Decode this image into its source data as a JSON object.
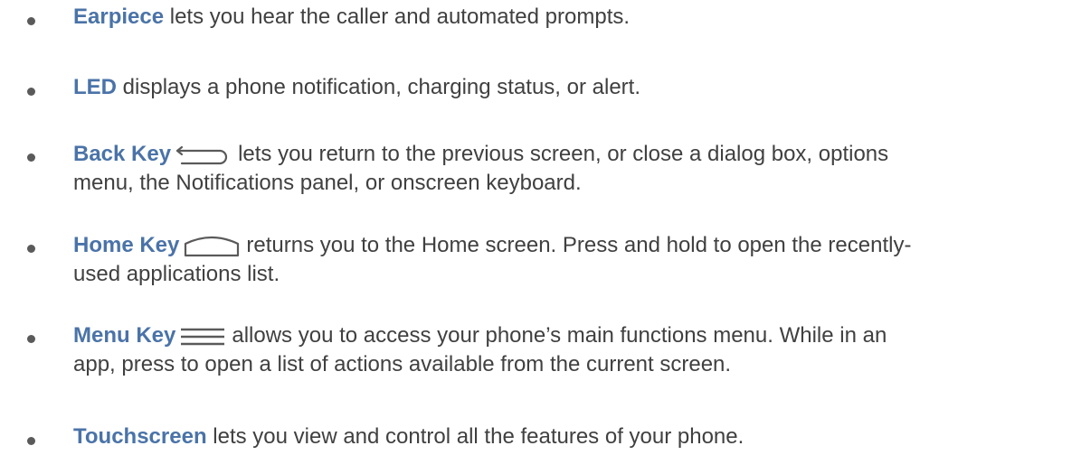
{
  "items": [
    {
      "term": "Earpiece",
      "text": " lets you hear the caller and automated prompts."
    },
    {
      "term": "LED",
      "text": " displays a phone notification, charging status, or alert."
    },
    {
      "term": "Back Key",
      "icon": "back-arrow-icon",
      "text_line1": "lets you return to the previous screen, or close a dialog box, options",
      "text_line2": "menu, the Notifications panel, or onscreen keyboard."
    },
    {
      "term": "Home Key",
      "icon": "home-outline-icon",
      "text_line1": "returns you to the Home screen. Press and hold to open the recently-",
      "text_line2": "used applications list."
    },
    {
      "term": "Menu Key",
      "icon": "menu-lines-icon",
      "text_line1": "allows you to access your phone’s main functions menu. While in an",
      "text_line2": "app, press to open a list of actions available from the current screen."
    },
    {
      "term": "Touchscreen",
      "text": " lets you view and control all the features of your phone."
    }
  ],
  "colors": {
    "term": "#4a73a8",
    "body_text": "#404040",
    "bullet": "#5a5a5a",
    "icon": "#5a5a5a"
  }
}
